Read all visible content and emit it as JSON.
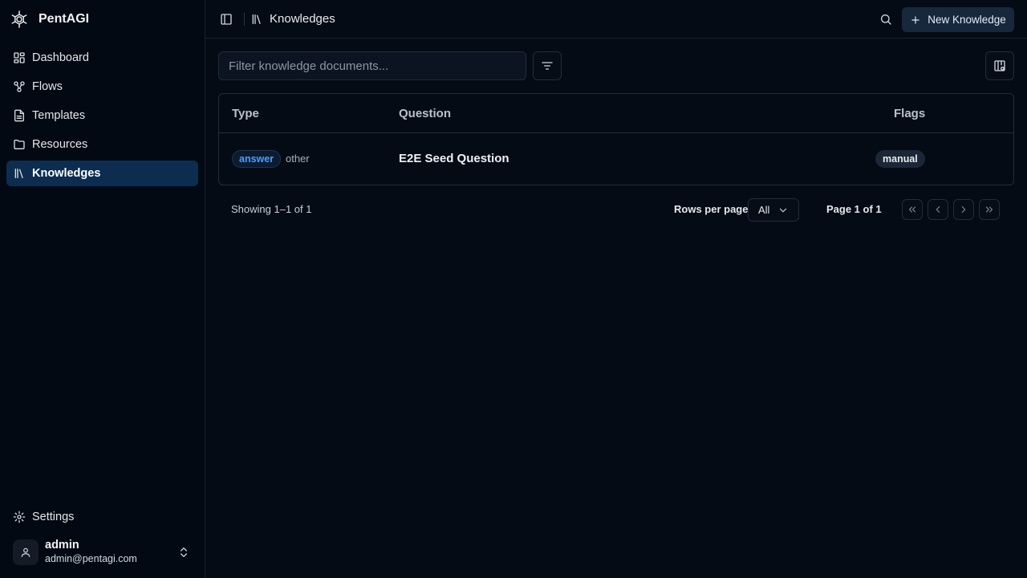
{
  "app": {
    "name": "PentAGI"
  },
  "sidebar": {
    "items": [
      {
        "label": "Dashboard",
        "icon": "dashboard-icon",
        "active": false
      },
      {
        "label": "Flows",
        "icon": "workflow-icon",
        "active": false
      },
      {
        "label": "Templates",
        "icon": "file-text-icon",
        "active": false
      },
      {
        "label": "Resources",
        "icon": "folder-icon",
        "active": false
      },
      {
        "label": "Knowledges",
        "icon": "library-icon",
        "active": true
      }
    ],
    "settings_label": "Settings",
    "user": {
      "name": "admin",
      "email": "admin@pentagi.com"
    }
  },
  "header": {
    "breadcrumb": "Knowledges",
    "new_button_label": "New Knowledge"
  },
  "toolbar": {
    "filter_placeholder": "Filter knowledge documents..."
  },
  "table": {
    "columns": [
      "Type",
      "Question",
      "Flags"
    ],
    "rows": [
      {
        "type_badge": "answer",
        "type_sub": "other",
        "question": "E2E Seed Question",
        "flag": "manual"
      }
    ]
  },
  "pagination": {
    "showing": "Showing 1–1 of 1",
    "rows_per_page_label": "Rows per page",
    "rows_per_page_value": "All",
    "page_label": "Page 1 of 1"
  },
  "colors": {
    "background": "#050b14",
    "sidebar_active": "#0c2d4f",
    "accent_blue": "#4d9fff",
    "border": "#222c3a"
  }
}
